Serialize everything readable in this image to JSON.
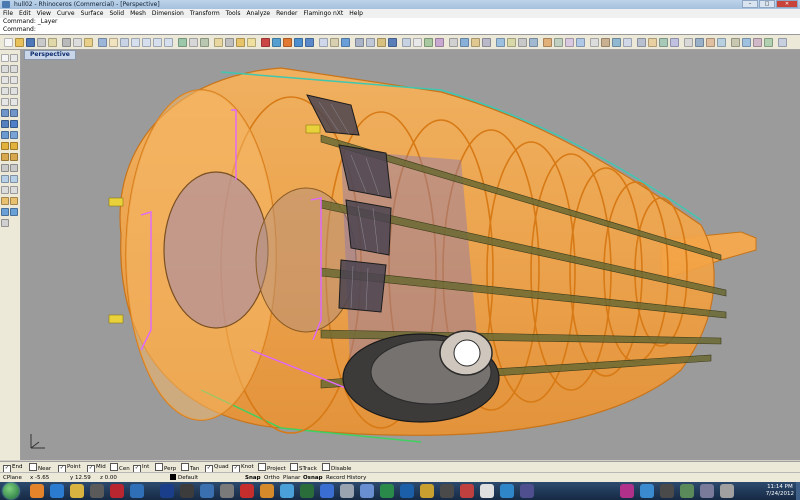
{
  "window": {
    "title": "hull02 - Rhinoceros (Commercial) - [Perspective]",
    "buttons": [
      "–",
      "□",
      "✕"
    ]
  },
  "menu": [
    "File",
    "Edit",
    "View",
    "Curve",
    "Surface",
    "Solid",
    "Mesh",
    "Dimension",
    "Transform",
    "Tools",
    "Analyze",
    "Render",
    "Flamingo nXt",
    "Help"
  ],
  "command_history": "Command: _Layer",
  "command_prompt": "Command:",
  "viewport": {
    "tab_label": "Perspective"
  },
  "osnap": [
    {
      "label": "End",
      "checked": true
    },
    {
      "label": "Near",
      "checked": false
    },
    {
      "label": "Point",
      "checked": true
    },
    {
      "label": "Mid",
      "checked": true
    },
    {
      "label": "Cen",
      "checked": false
    },
    {
      "label": "Int",
      "checked": true
    },
    {
      "label": "Perp",
      "checked": false
    },
    {
      "label": "Tan",
      "checked": false
    },
    {
      "label": "Quad",
      "checked": true
    },
    {
      "label": "Knot",
      "checked": true
    },
    {
      "label": "Project",
      "checked": false
    },
    {
      "label": "STrack",
      "checked": false
    },
    {
      "label": "Disable",
      "checked": false
    }
  ],
  "status": {
    "cplane": "CPlane",
    "x": "x -5.65",
    "y": "y 12.59",
    "z": "z 0.00",
    "layer": "Default",
    "snap": "Snap",
    "ortho": "Ortho",
    "planar": "Planar",
    "osnap": "Osnap",
    "record_history": "Record History"
  },
  "clock": {
    "time": "11:14 PM",
    "date": "7/24/2012"
  },
  "colors": {
    "viewport_bg": "#9b9b9b",
    "hull_orange": "#f4a44a",
    "bulkhead_edge": "#d77a16",
    "stringer": "#5b5a2c",
    "selection_magenta": "#e060ff",
    "taskbar": "#1e3656"
  }
}
